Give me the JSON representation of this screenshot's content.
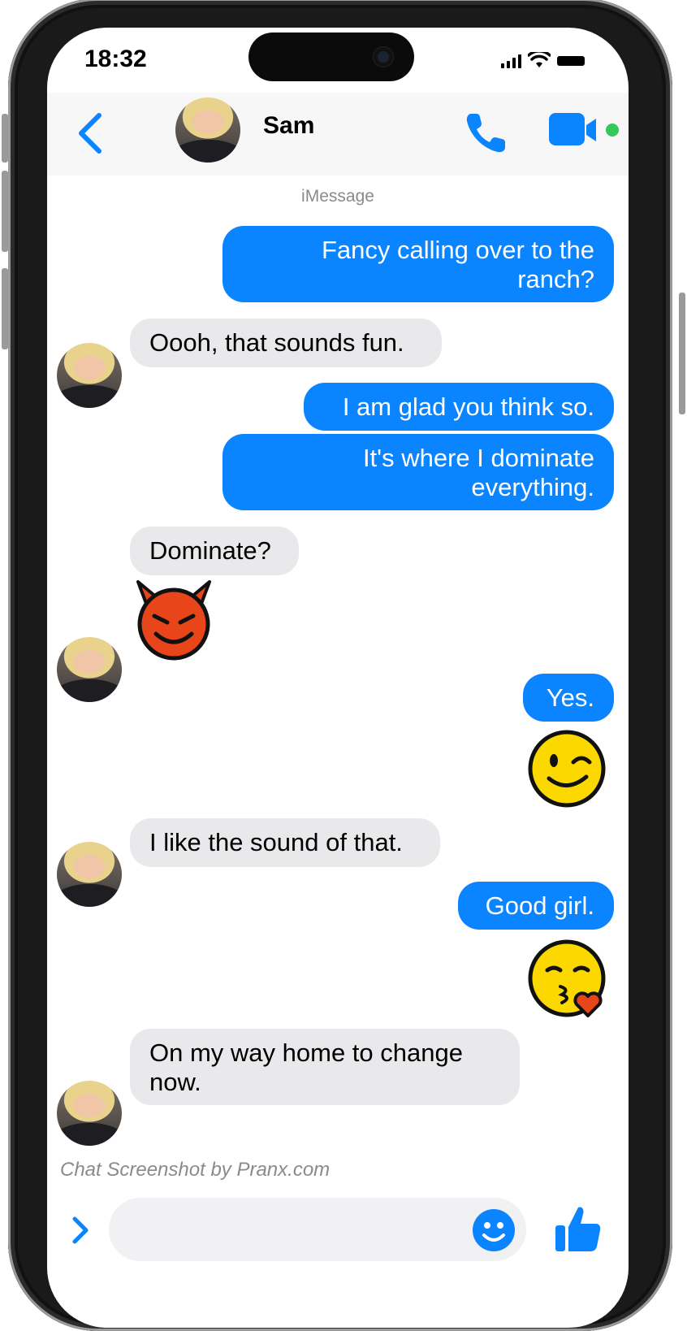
{
  "status_bar": {
    "time": "18:32"
  },
  "header": {
    "contact_name": "Sam"
  },
  "service_label": "iMessage",
  "messages": [
    {
      "dir": "out",
      "text": "Fancy calling over to the ranch?"
    },
    {
      "dir": "in",
      "text": "Oooh, that sounds fun."
    },
    {
      "dir": "out",
      "text": "I am glad you think so."
    },
    {
      "dir": "out",
      "text": "It's where I dominate everything."
    },
    {
      "dir": "in",
      "text": "Dominate?"
    },
    {
      "dir": "in",
      "emoji": "smiling-devil-icon"
    },
    {
      "dir": "out",
      "text": "Yes."
    },
    {
      "dir": "out",
      "emoji": "winking-face-icon"
    },
    {
      "dir": "in",
      "text": "I like the sound of that."
    },
    {
      "dir": "out",
      "text": "Good girl."
    },
    {
      "dir": "out",
      "emoji": "kissing-face-heart-icon"
    },
    {
      "dir": "in",
      "text": "On my way home to change now."
    }
  ],
  "watermark": "Chat Screenshot by Pranx.com",
  "composer": {
    "placeholder": ""
  },
  "colors": {
    "accent": "#0a84ff",
    "outgoing_bubble": "#0a84ff",
    "incoming_bubble": "#e9e9eb",
    "online_dot": "#34c759"
  }
}
